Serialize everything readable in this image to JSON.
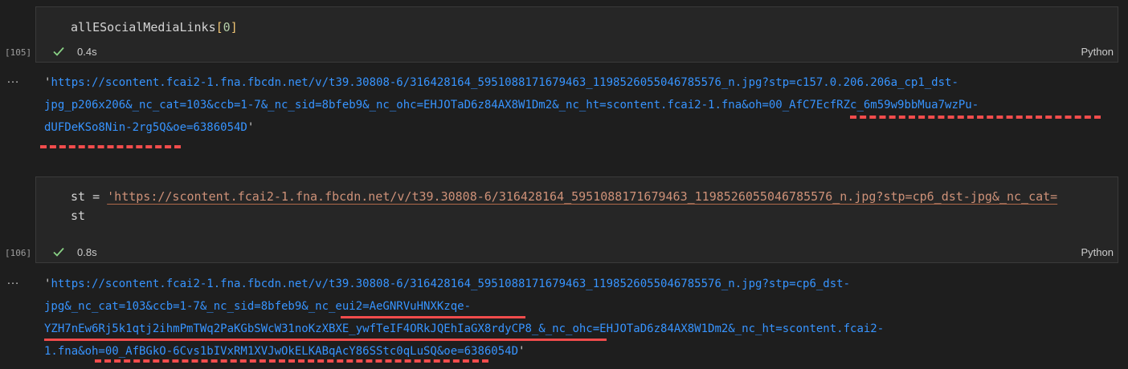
{
  "cell1": {
    "code_identifier": "allESocialMediaLinks",
    "code_bracket_open": "[",
    "code_index": "0",
    "code_bracket_close": "]",
    "exec_count": "[105]",
    "time": "0.4s",
    "language": "Python"
  },
  "output1": {
    "menu": "…",
    "open_quote": "'",
    "line1": "https://scontent.fcai2-1.fna.fbcdn.net/v/t39.30808-6/316428164_5951088171679463_1198526055046785576_n.jpg?stp=c157.0.206.206a_cp1_dst-",
    "line2": "jpg_p206x206&_nc_cat=103&ccb=1-7&_nc_sid=8bfeb9&_nc_ohc=EHJOTaD6z84AX8W1Dm2&_nc_ht=scontent.fcai2-1.fna&oh=00_AfC7EcfRZc_6m59w9bbMua7wzPu-",
    "line3": "dUFDeKSo8Nin-2rg5Q&oe=6386054D",
    "close_quote": "'"
  },
  "cell2": {
    "line1_var": "st = ",
    "line1_string": "'https://scontent.fcai2-1.fna.fbcdn.net/v/t39.30808-6/316428164_5951088171679463_1198526055046785576_n.jpg?stp=cp6_dst-jpg&_nc_cat=",
    "line2": "st",
    "exec_count": "[106]",
    "time": "0.8s",
    "language": "Python"
  },
  "output2": {
    "menu": "…",
    "open_quote": "'",
    "line1": "https://scontent.fcai2-1.fna.fbcdn.net/v/t39.30808-6/316428164_5951088171679463_1198526055046785576_n.jpg?stp=cp6_dst-",
    "line2": "jpg&_nc_cat=103&ccb=1-7&_nc_sid=8bfeb9&_nc_eui2=AeGNRVuHNXKzqe-",
    "line3": "YZH7nEw6Rj5k1qtj2ihmPmTWq2PaKGbSWcW31noKzXBXE_ywfTeIF4ORkJQEhIaGX8rdyCP8_&_nc_ohc=EHJOTaD6z84AX8W1Dm2&_nc_ht=scontent.fcai2-",
    "line4": "1.fna&oh=00_AfBGkO-6Cvs1bIVxRM1XVJwOkELKABqAcY86SStc0qLuSQ&oe=6386054D",
    "close_quote": "'"
  },
  "colors": {
    "background": "#1e1e1e",
    "cell_background": "#262626",
    "link": "#3794ff",
    "string": "#ce9178",
    "check": "#89d185",
    "annotation": "#f14c4c"
  },
  "icons": {
    "status": "check-icon",
    "output_menu": "more-icon"
  }
}
